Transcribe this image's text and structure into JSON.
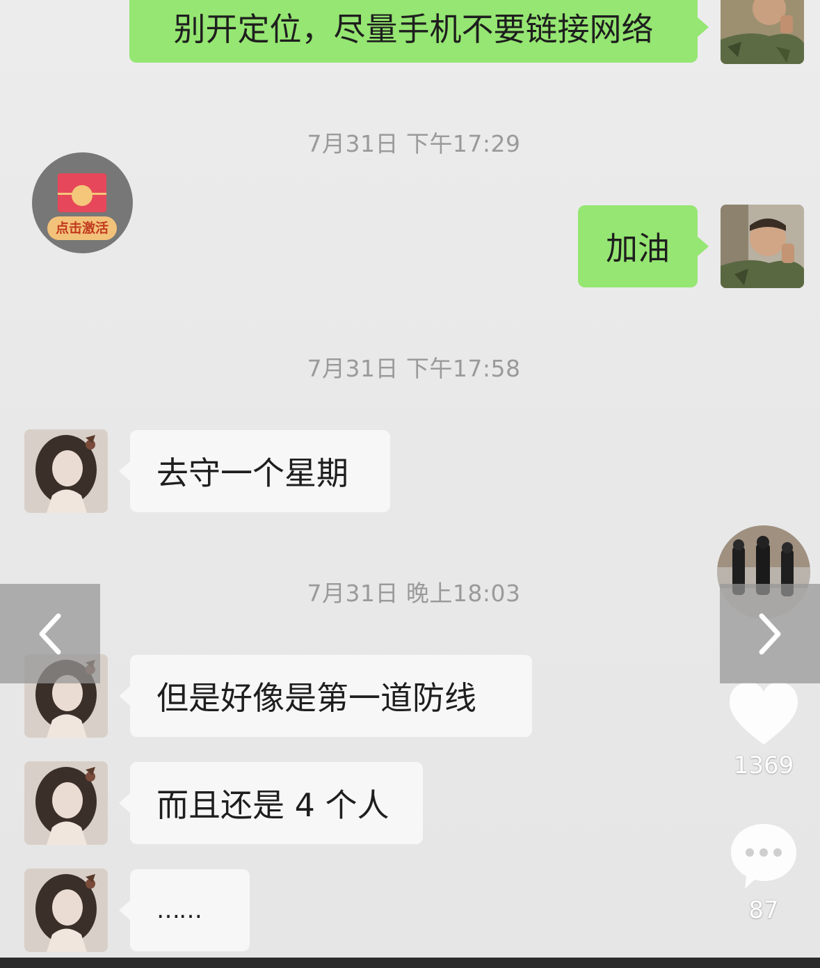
{
  "messages": {
    "top_outgoing": "别开定位，尽量手机不要链接网络",
    "ts1": "7月31日 下午17:29",
    "outgoing_1": "加油",
    "ts2": "7月31日 下午17:58",
    "incoming_1": "去守一个星期",
    "ts3": "7月31日 晚上18:03",
    "incoming_2": "但是好像是第一道防线",
    "incoming_3": "而且还是 4 个人",
    "incoming_4": "……"
  },
  "red_packet": {
    "label": "点击激活",
    "icon": "red-envelope-icon"
  },
  "navigation": {
    "prev_icon": "chevron-left-icon",
    "next_icon": "chevron-right-icon"
  },
  "side_rail": {
    "likes": "1369",
    "comments": "87",
    "like_icon": "heart-icon",
    "comment_icon": "comment-bubble-icon"
  },
  "colors": {
    "outgoing_bubble": "#95e672",
    "incoming_bubble": "#f7f7f7",
    "timestamp": "#9a9a9a",
    "background": "#e6e6e6"
  }
}
